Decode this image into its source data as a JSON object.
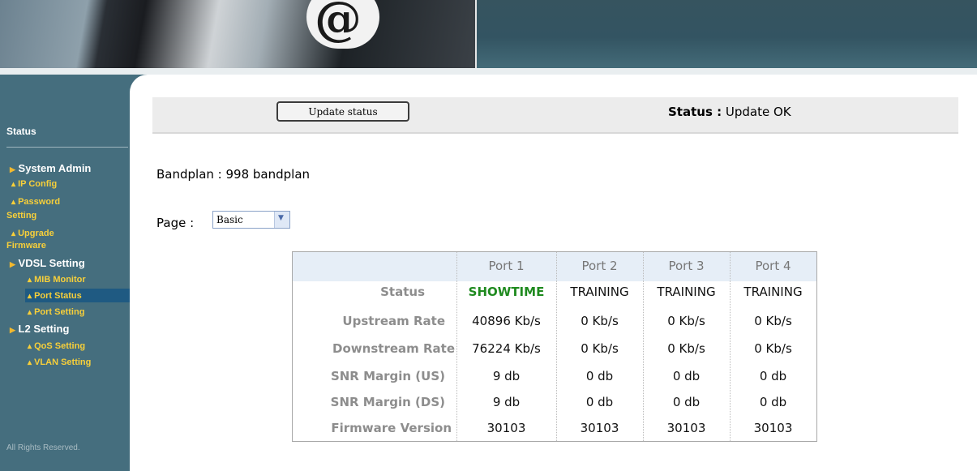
{
  "sidebar": {
    "title": "Status",
    "footer": "All Rights Reserved.",
    "items": [
      {
        "label": "System Admin"
      },
      {
        "label": "IP Config"
      },
      {
        "label": "Password"
      },
      {
        "label": "Setting"
      },
      {
        "label": "Upgrade"
      },
      {
        "label": "Firmware"
      },
      {
        "label": "VDSL Setting"
      },
      {
        "label": "MIB Monitor"
      },
      {
        "label": "Port Status"
      },
      {
        "label": "Port Setting"
      },
      {
        "label": "L2 Setting"
      },
      {
        "label": "QoS Setting"
      },
      {
        "label": "VLAN Setting"
      }
    ]
  },
  "status_bar": {
    "button_label": "Update status",
    "status_label": "Status :",
    "status_value": "Update OK"
  },
  "bandplan": "Bandplan : 998 bandplan",
  "page": {
    "label": "Page :",
    "selected": "Basic"
  },
  "table": {
    "headers": [
      "Port 1",
      "Port 2",
      "Port 3",
      "Port 4"
    ],
    "rows": [
      {
        "label": "Status",
        "values": [
          "SHOWTIME",
          "TRAINING",
          "TRAINING",
          "TRAINING"
        ]
      },
      {
        "label": "Upstream Rate",
        "values": [
          "40896 Kb/s",
          "0 Kb/s",
          "0 Kb/s",
          "0 Kb/s"
        ]
      },
      {
        "label": "Downstream Rate",
        "values": [
          "76224 Kb/s",
          "0 Kb/s",
          "0 Kb/s",
          "0 Kb/s"
        ]
      },
      {
        "label": "SNR Margin (US)",
        "values": [
          "9 db",
          "0 db",
          "0 db",
          "0 db"
        ]
      },
      {
        "label": "SNR Margin (DS)",
        "values": [
          "9 db",
          "0 db",
          "0 db",
          "0 db"
        ]
      },
      {
        "label": "Firmware Version",
        "values": [
          "30103",
          "30103",
          "30103",
          "30103"
        ]
      }
    ]
  },
  "colors": {
    "sidebar": "#456e7e",
    "submenu": "#f7cf3a",
    "showtime": "#1f8a1f",
    "active_nav": "#1f5a82"
  }
}
